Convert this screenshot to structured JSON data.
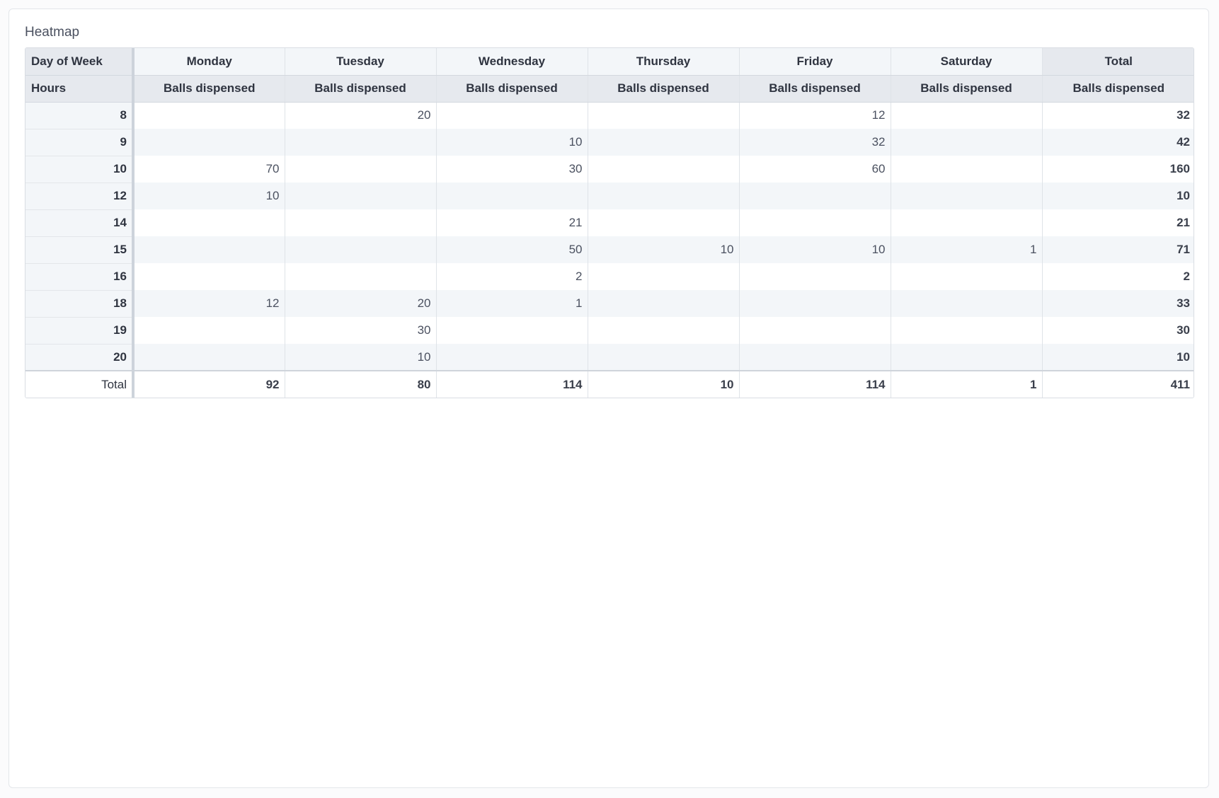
{
  "panel": {
    "title": "Heatmap"
  },
  "pivot": {
    "corner_top": "Day of Week",
    "corner_bottom": "Hours",
    "columns": [
      "Monday",
      "Tuesday",
      "Wednesday",
      "Thursday",
      "Friday",
      "Saturday",
      "Total"
    ],
    "measure": "Balls dispensed",
    "rows": [
      {
        "hour": "8",
        "cells": [
          "",
          "20",
          "",
          "",
          "12",
          "",
          "32"
        ]
      },
      {
        "hour": "9",
        "cells": [
          "",
          "",
          "10",
          "",
          "32",
          "",
          "42"
        ]
      },
      {
        "hour": "10",
        "cells": [
          "70",
          "",
          "30",
          "",
          "60",
          "",
          "160"
        ]
      },
      {
        "hour": "12",
        "cells": [
          "10",
          "",
          "",
          "",
          "",
          "",
          "10"
        ]
      },
      {
        "hour": "14",
        "cells": [
          "",
          "",
          "21",
          "",
          "",
          "",
          "21"
        ]
      },
      {
        "hour": "15",
        "cells": [
          "",
          "",
          "50",
          "10",
          "10",
          "1",
          "71"
        ]
      },
      {
        "hour": "16",
        "cells": [
          "",
          "",
          "2",
          "",
          "",
          "",
          "2"
        ]
      },
      {
        "hour": "18",
        "cells": [
          "12",
          "20",
          "1",
          "",
          "",
          "",
          "33"
        ]
      },
      {
        "hour": "19",
        "cells": [
          "",
          "30",
          "",
          "",
          "",
          "",
          "30"
        ]
      },
      {
        "hour": "20",
        "cells": [
          "",
          "10",
          "",
          "",
          "",
          "",
          "10"
        ]
      }
    ],
    "total_row": {
      "label": "Total",
      "cells": [
        "92",
        "80",
        "114",
        "10",
        "114",
        "1",
        "411"
      ]
    }
  }
}
